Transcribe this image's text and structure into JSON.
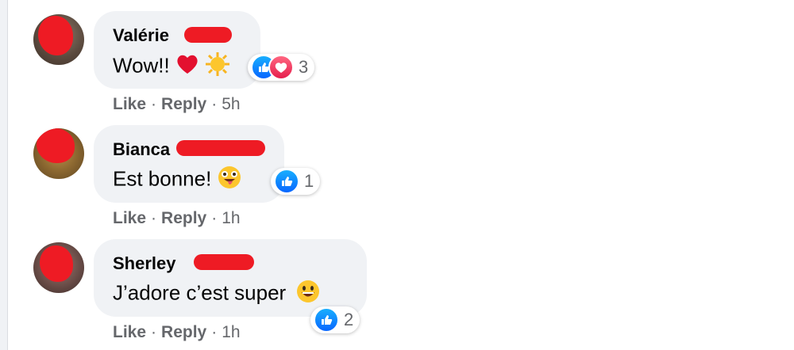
{
  "comments": [
    {
      "author": "Valérie",
      "text": "Wow!!",
      "emojis": [
        "red-heart-icon",
        "sun-icon"
      ],
      "reactions": {
        "types": [
          "like",
          "love"
        ],
        "count": "3"
      },
      "actions": {
        "like": "Like",
        "reply": "Reply",
        "time": "5h"
      }
    },
    {
      "author": "Bianca",
      "text": "Est bonne!",
      "emojis": [
        "zany-face-icon"
      ],
      "reactions": {
        "types": [
          "like"
        ],
        "count": "1"
      },
      "actions": {
        "like": "Like",
        "reply": "Reply",
        "time": "1h"
      }
    },
    {
      "author": "Sherley",
      "text": "J’adore c’est super",
      "emojis": [
        "grinning-face-icon"
      ],
      "reactions": {
        "types": [
          "like"
        ],
        "count": "2"
      },
      "actions": {
        "like": "Like",
        "reply": "Reply",
        "time": "1h"
      }
    }
  ],
  "separator": "·",
  "colors": {
    "bubble": "#f0f2f5",
    "like": "#0866ff",
    "love": "#e61e4d",
    "meta": "#65676b",
    "redaction": "#ee1b24"
  }
}
